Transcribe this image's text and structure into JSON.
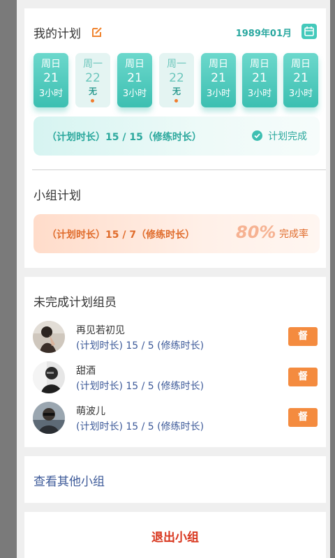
{
  "colors": {
    "accent_teal": "#3cbfb1",
    "accent_orange": "#f48b3f",
    "link_blue": "#3d5a99",
    "exit_red": "#d8361e"
  },
  "plan": {
    "title": "我的计划",
    "edit_icon": "edit-icon",
    "year_month": "1989年01月",
    "calendar_icon": "calendar-icon",
    "days": [
      {
        "weekday": "周日",
        "date": "21",
        "hours": "3小时",
        "state": "active"
      },
      {
        "weekday": "周一",
        "date": "22",
        "hours": "无",
        "state": "inactive"
      },
      {
        "weekday": "周日",
        "date": "21",
        "hours": "3小时",
        "state": "active"
      },
      {
        "weekday": "周一",
        "date": "22",
        "hours": "无",
        "state": "inactive"
      },
      {
        "weekday": "周日",
        "date": "21",
        "hours": "3小时",
        "state": "active"
      },
      {
        "weekday": "周日",
        "date": "21",
        "hours": "3小时",
        "state": "active"
      },
      {
        "weekday": "周日",
        "date": "21",
        "hours": "3小时",
        "state": "active"
      }
    ],
    "summary": "（计划时长）15 / 15（修练时长）",
    "status": "计划完成"
  },
  "group": {
    "title": "小组计划",
    "summary": "（计划时长）15 / 7（修练时长）",
    "rate": "80%",
    "rate_label": "完成率"
  },
  "members": {
    "title": "未完成计划组员",
    "list": [
      {
        "name": "再见若初见",
        "stat": "(计划时长) 15 / 5 (修练时长)",
        "button": "督"
      },
      {
        "name": "甜酒",
        "stat": "(计划时长) 15 / 5 (修练时长)",
        "button": "督"
      },
      {
        "name": "萌波儿",
        "stat": "(计划时长) 15 / 5 (修练时长)",
        "button": "督"
      }
    ]
  },
  "other_groups_link": "查看其他小组",
  "exit_button": "退出小组"
}
